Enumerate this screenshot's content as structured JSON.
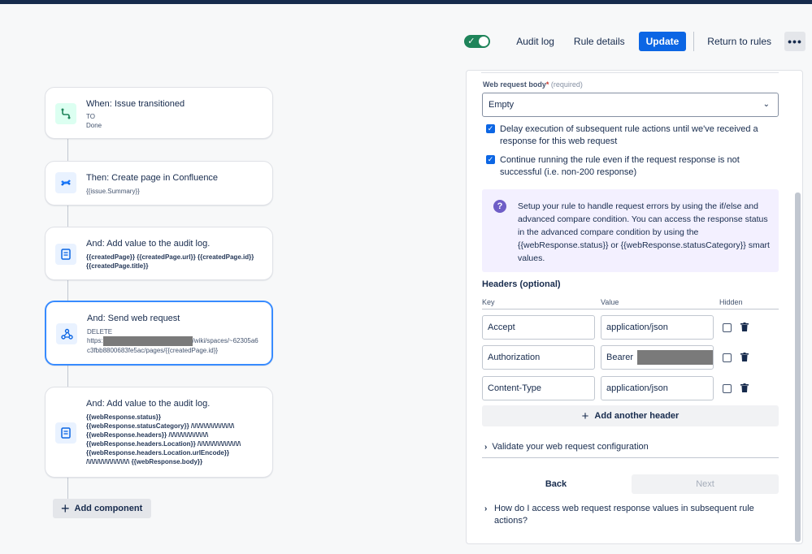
{
  "header": {
    "toggle_state": "on",
    "audit_log": "Audit log",
    "rule_details": "Rule details",
    "update": "Update",
    "return_to_rules": "Return to rules",
    "more": "•••"
  },
  "flow": {
    "trigger": {
      "title": "When: Issue transitioned",
      "line1": "TO",
      "line2": "Done"
    },
    "create_page": {
      "title": "Then: Create page in Confluence",
      "line1": "{{issue.Summary}}"
    },
    "audit1": {
      "title": "And: Add value to the audit log.",
      "line1": "{{createdPage}} {{createdPage.url}} {{createdPage.id}}",
      "line2": "{{createdPage.title}}"
    },
    "web_request": {
      "title": "And: Send web request",
      "line1": "DELETE",
      "line2_prefix": "https:",
      "line2_suffix": "/wiki/spaces/~62305a6",
      "line3": "c3fbb8800683fe5ac/pages/{{createdPage.id}}"
    },
    "audit2": {
      "title": "And: Add value to the audit log.",
      "lines": [
        "{{webResponse.status}}",
        "{{webResponse.statusCategory}} /\\/\\/\\/\\/\\/\\/\\/\\/\\/\\/\\/\\",
        "{{webResponse.headers}} /\\/\\/\\/\\/\\/\\/\\/\\/\\/\\/\\",
        "{{webResponse.headers.Location}} /\\/\\/\\/\\/\\/\\/\\/\\/\\/\\/\\/\\",
        "{{webResponse.headers.Location.urlEncode}}",
        "/\\/\\/\\/\\/\\/\\/\\/\\/\\/\\/\\/\\ {{webResponse.body}}"
      ]
    },
    "add_component": "Add component"
  },
  "panel": {
    "body_label": "Web request body",
    "body_required_mark": "*",
    "body_required_text": "(required)",
    "body_value": "Empty",
    "delay_checkbox": "Delay execution of subsequent rule actions until we've received a response for this web request",
    "continue_checkbox": "Continue running the rule even if the request response is not successful (i.e. non-200 response)",
    "info_text": "Setup your rule to handle request errors by using the if/else and advanced compare condition. You can access the response status in the advanced compare condition by using the {{webResponse.status}} or {{webResponse.statusCategory}} smart values.",
    "headers_title": "Headers (optional)",
    "col_key": "Key",
    "col_value": "Value",
    "col_hidden": "Hidden",
    "headers": [
      {
        "key": "Accept",
        "value": "application/json"
      },
      {
        "key": "Authorization",
        "value": "Bearer"
      },
      {
        "key": "Content-Type",
        "value": "application/json"
      }
    ],
    "add_header": "Add another header",
    "validate": "Validate your web request configuration",
    "back": "Back",
    "next": "Next",
    "howto": "How do I access web request response values in subsequent rule actions?"
  },
  "colors": {
    "primary": "#0c66e4",
    "toggle_on": "#1f845a",
    "selected_border": "#388bff",
    "info_bg": "#f3f0ff"
  }
}
